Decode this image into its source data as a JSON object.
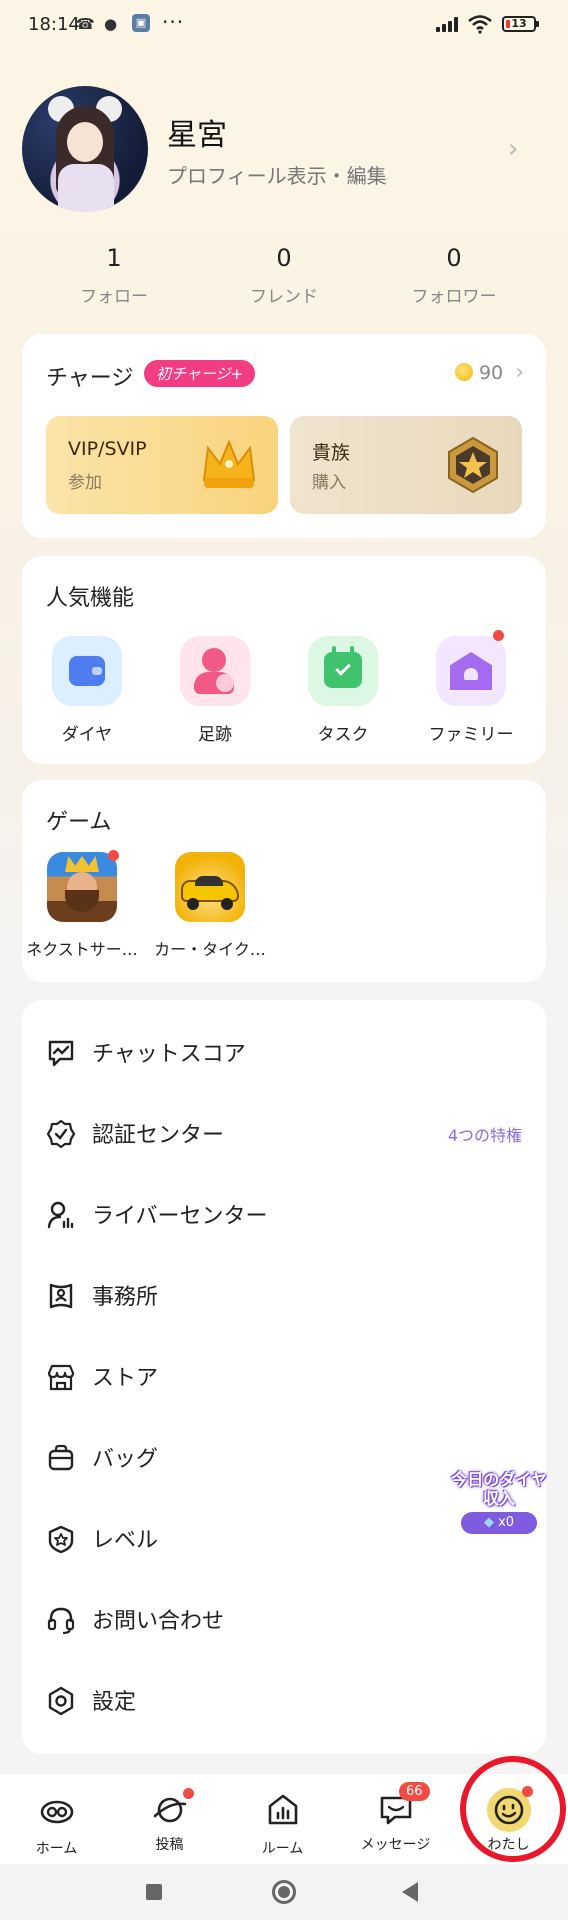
{
  "status_bar": {
    "time": "18:14",
    "battery": "13"
  },
  "profile": {
    "name": "星宮",
    "subtitle": "プロフィール表示・編集",
    "stats": [
      {
        "value": "1",
        "label": "フォロー"
      },
      {
        "value": "0",
        "label": "フレンド"
      },
      {
        "value": "0",
        "label": "フォロワー"
      }
    ]
  },
  "charge": {
    "title": "チャージ",
    "badge": "初チャージ+",
    "coins": "90",
    "tiles": [
      {
        "title": "VIP/SVIP",
        "sub": "参加"
      },
      {
        "title": "貴族",
        "sub": "購入"
      }
    ]
  },
  "features": {
    "title": "人気機能",
    "items": [
      {
        "label": "ダイヤ",
        "icon": "wallet-icon"
      },
      {
        "label": "足跡",
        "icon": "footprint-icon"
      },
      {
        "label": "タスク",
        "icon": "calendar-check-icon"
      },
      {
        "label": "ファミリー",
        "icon": "family-house-icon"
      }
    ]
  },
  "games": {
    "title": "ゲーム",
    "items": [
      {
        "label": "ネクストサー…"
      },
      {
        "label": "カー・タイク…"
      }
    ]
  },
  "menu": [
    {
      "label": "チャットスコア",
      "icon": "chat-score-icon",
      "right": ""
    },
    {
      "label": "認証センター",
      "icon": "verified-badge-icon",
      "right": "4つの特権"
    },
    {
      "label": "ライバーセンター",
      "icon": "liver-icon",
      "right": ""
    },
    {
      "label": "事務所",
      "icon": "agency-icon",
      "right": ""
    },
    {
      "label": "ストア",
      "icon": "store-icon",
      "right": ""
    },
    {
      "label": "バッグ",
      "icon": "bag-icon",
      "right": ""
    },
    {
      "label": "レベル",
      "icon": "level-icon",
      "right": ""
    },
    {
      "label": "お問い合わせ",
      "icon": "headset-icon",
      "right": ""
    },
    {
      "label": "設定",
      "icon": "settings-icon",
      "right": ""
    }
  ],
  "floating": {
    "line1": "今日のダイヤ",
    "line2": "収入",
    "count": "x0"
  },
  "nav": [
    {
      "label": "ホーム"
    },
    {
      "label": "投稿"
    },
    {
      "label": "ルーム"
    },
    {
      "label": "メッセージ",
      "badge": "66"
    },
    {
      "label": "わたし"
    }
  ]
}
